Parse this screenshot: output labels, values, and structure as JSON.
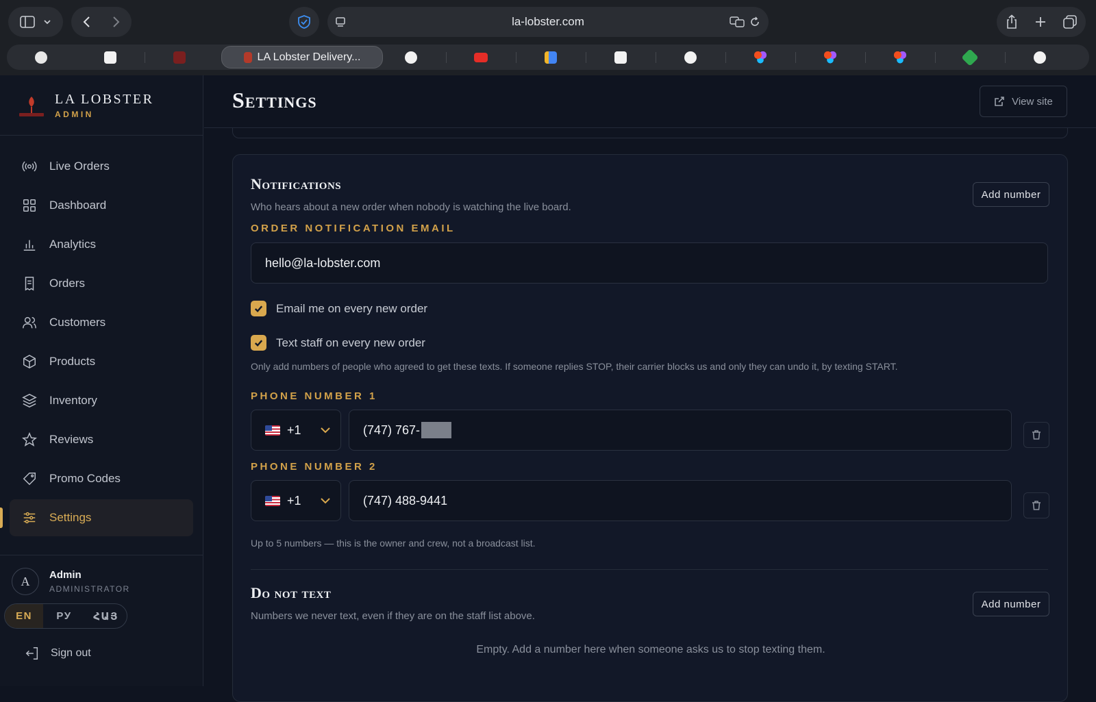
{
  "browser": {
    "url": "la-lobster.com",
    "active_tab": "LA Lobster Delivery..."
  },
  "brand": {
    "title": "LA LOBSTER",
    "subtitle": "ADMIN"
  },
  "nav": {
    "live_orders": "Live Orders",
    "dashboard": "Dashboard",
    "analytics": "Analytics",
    "orders": "Orders",
    "customers": "Customers",
    "products": "Products",
    "inventory": "Inventory",
    "reviews": "Reviews",
    "promo_codes": "Promo Codes",
    "settings": "Settings"
  },
  "user": {
    "initial": "A",
    "name": "Admin",
    "role": "ADMINISTRATOR"
  },
  "languages": [
    "EN",
    "РУ",
    "ՀԱՅ"
  ],
  "sign_out": "Sign out",
  "page": {
    "title": "Settings",
    "view_site": "View site"
  },
  "notifications": {
    "title": "Notifications",
    "description": "Who hears about a new order when nobody is watching the live board.",
    "add_number": "Add number",
    "email_label": "ORDER NOTIFICATION EMAIL",
    "email_value": "hello@la-lobster.com",
    "email_each_order": "Email me on every new order",
    "text_staff": "Text staff on every new order",
    "consent_note": "Only add numbers of people who agreed to get these texts. If someone replies STOP, their carrier blocks us and only they can undo it, by texting START.",
    "phone1_label": "PHONE NUMBER 1",
    "phone1_code": "+1",
    "phone1_value": "(747) 767-",
    "phone2_label": "PHONE NUMBER 2",
    "phone2_code": "+1",
    "phone2_value": "(747) 488-9441",
    "limit_note": "Up to 5 numbers — this is the owner and crew, not a broadcast list."
  },
  "do_not_text": {
    "title": "Do not text",
    "description": "Numbers we never text, even if they are on the staff list above.",
    "add_number": "Add number",
    "empty": "Empty. Add a number here when someone asks us to stop texting them."
  },
  "colors": {
    "accent": "#d9a84e",
    "background": "#0f1420",
    "card": "#121828"
  }
}
